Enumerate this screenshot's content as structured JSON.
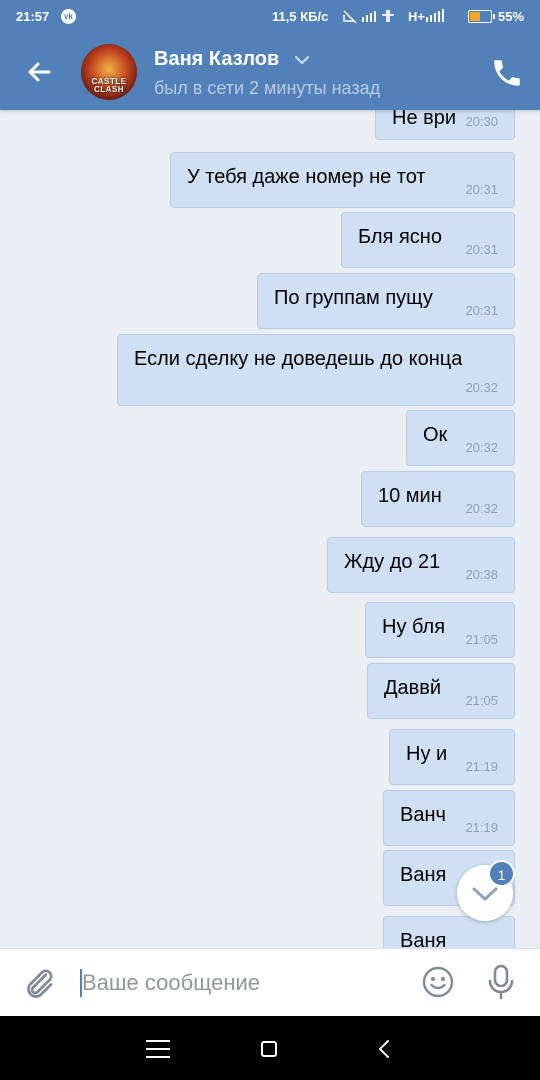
{
  "status_bar": {
    "time": "21:57",
    "app_badge": "vk",
    "network_speed": "11,5 КБ/с",
    "network_type": "H+",
    "battery_percent": "55%",
    "battery_level": 0.55
  },
  "header": {
    "contact_name": "Ваня Казлов",
    "last_seen": "был в сети 2 минуты назад",
    "avatar_caption": "CASTLE\nCLASH"
  },
  "messages": [
    {
      "text": "Не ври",
      "time": "20:30"
    },
    {
      "text": "У тебя даже номер не тот",
      "time": "20:31"
    },
    {
      "text": "Бля ясно",
      "time": "20:31"
    },
    {
      "text": "По группам пущу",
      "time": "20:31"
    },
    {
      "text": "Если сделку не доведешь до конца",
      "time": "20:32"
    },
    {
      "text": "Ок",
      "time": "20:32"
    },
    {
      "text": "10 мин",
      "time": "20:32"
    },
    {
      "text": "Жду до 21",
      "time": "20:38"
    },
    {
      "text": "Ну бля",
      "time": "21:05"
    },
    {
      "text": "Даввй",
      "time": "21:05"
    },
    {
      "text": "Ну и",
      "time": "21:19"
    },
    {
      "text": "Ванч",
      "time": "21:19"
    },
    {
      "text": "Ваня",
      "time": ""
    },
    {
      "text": "Ваня",
      "time": ""
    }
  ],
  "scroll_down": {
    "unread_count": "1"
  },
  "composer": {
    "placeholder": "Ваше сообщение"
  },
  "colors": {
    "accent": "#5181b8",
    "bubble": "#cfe0f5",
    "background": "#ebeff4"
  },
  "icons": [
    "back-arrow-icon",
    "chevron-down-icon",
    "phone-icon",
    "paperclip-icon",
    "smile-icon",
    "microphone-icon",
    "menu-icon",
    "home-icon",
    "back-icon"
  ]
}
